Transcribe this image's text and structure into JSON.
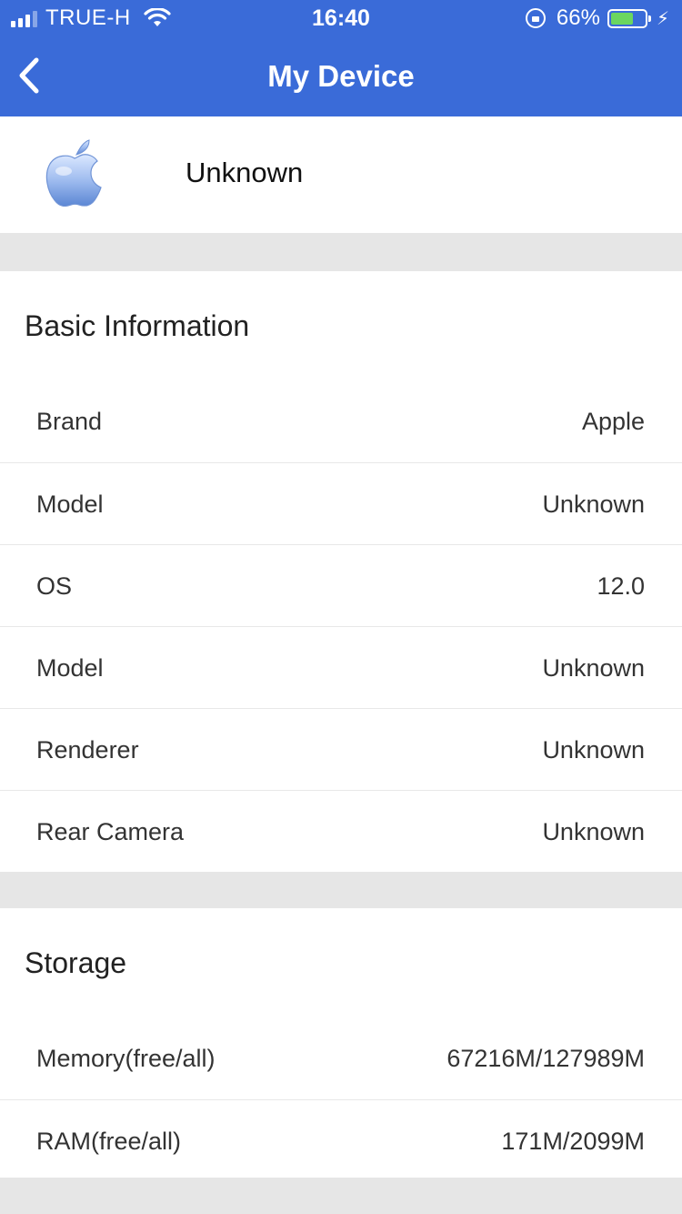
{
  "status_bar": {
    "carrier": "TRUE-H",
    "time": "16:40",
    "battery_percent": "66%",
    "battery_level": 0.66,
    "icons": [
      "signal-icon",
      "wifi-icon",
      "rotation-lock-icon",
      "battery-icon",
      "charging-icon"
    ]
  },
  "nav": {
    "title": "My Device",
    "back_icon": "chevron-left-icon"
  },
  "device": {
    "name": "Unknown",
    "logo_icon": "apple-logo-icon"
  },
  "basic_info": {
    "title": "Basic Information",
    "rows": [
      {
        "label": "Brand",
        "value": "Apple"
      },
      {
        "label": "Model",
        "value": "Unknown"
      },
      {
        "label": "OS",
        "value": "12.0"
      },
      {
        "label": "Model",
        "value": "Unknown"
      },
      {
        "label": "Renderer",
        "value": "Unknown"
      },
      {
        "label": "Rear Camera",
        "value": "Unknown"
      }
    ]
  },
  "storage": {
    "title": "Storage",
    "rows": [
      {
        "label": "Memory(free/all)",
        "value": "67216M/127989M"
      },
      {
        "label": "RAM(free/all)",
        "value": "171M/2099M"
      }
    ]
  },
  "colors": {
    "accent": "#3a6bd8",
    "background": "#e6e6e6",
    "battery_fill": "#6bd65f"
  }
}
